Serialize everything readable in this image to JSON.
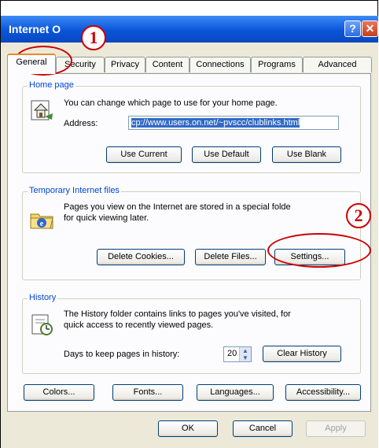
{
  "window": {
    "title": "Internet O",
    "help_glyph": "?",
    "close_glyph": "✕"
  },
  "tabs": [
    {
      "label": "General"
    },
    {
      "label": "Security"
    },
    {
      "label": "Privacy"
    },
    {
      "label": "Content"
    },
    {
      "label": "Connections"
    },
    {
      "label": "Programs"
    },
    {
      "label": "Advanced"
    }
  ],
  "home_page": {
    "title": "Home page",
    "description": "You can change which page to use for your home page.",
    "address_label": "Address:",
    "address_value": "cp://www.users.on.net/~pvscc/clublinks.html",
    "use_current": "Use Current",
    "use_default": "Use Default",
    "use_blank": "Use Blank"
  },
  "temp_files": {
    "title": "Temporary Internet files",
    "description_line1": "Pages you view on the Internet are stored in a special folde",
    "description_line2": "for quick viewing later.",
    "delete_cookies": "Delete Cookies...",
    "delete_files": "Delete Files...",
    "settings": "Settings..."
  },
  "history": {
    "title": "History",
    "description_line1": "The History folder contains links to pages you've visited, for",
    "description_line2": "quick access to recently viewed pages.",
    "days_label": "Days to keep pages in history:",
    "days_value": "20",
    "clear_history": "Clear History"
  },
  "bottom_buttons": {
    "colors": "Colors...",
    "fonts": "Fonts...",
    "languages": "Languages...",
    "accessibility": "Accessibility..."
  },
  "dialog_buttons": {
    "ok": "OK",
    "cancel": "Cancel",
    "apply": "Apply"
  },
  "annotations": {
    "marker1": "1",
    "marker2": "2",
    "color": "#cc0000"
  }
}
